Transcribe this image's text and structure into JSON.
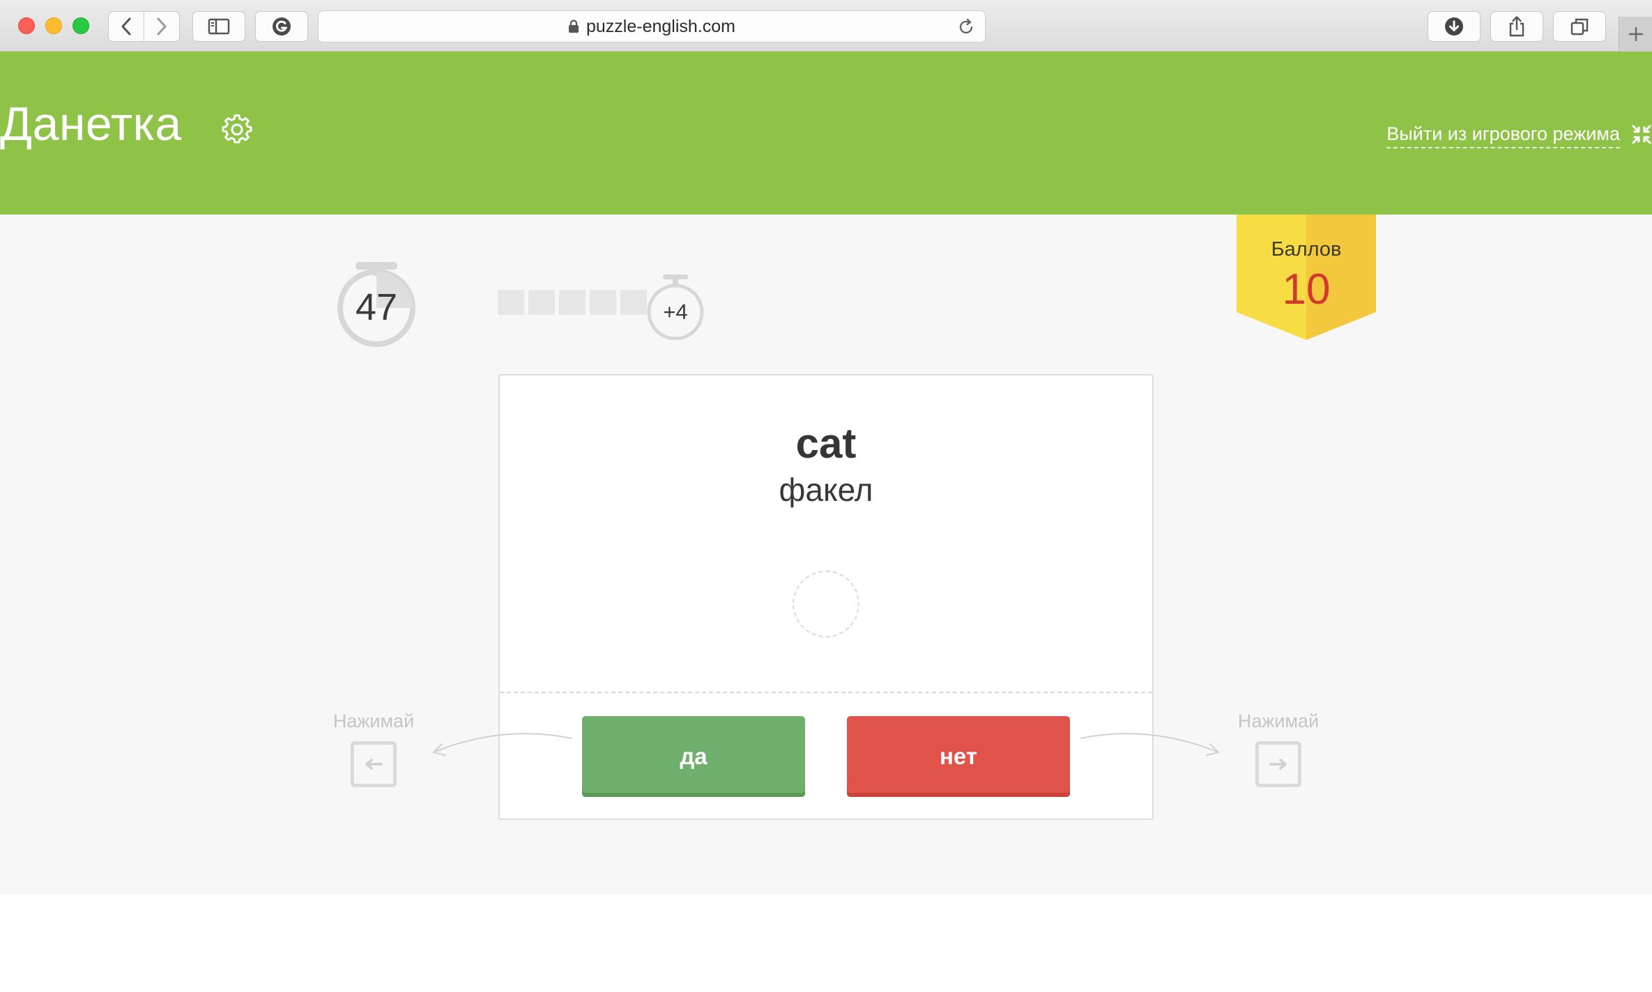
{
  "browser": {
    "url": "puzzle-english.com"
  },
  "header": {
    "title": "Данетка",
    "exit_label": "Выйти из игрового режима"
  },
  "game": {
    "timer_seconds": "47",
    "streak_cells_filled": 0,
    "streak_cells_total": 5,
    "bonus": "+4",
    "score_label": "Баллов",
    "score_value": "10",
    "word": "cat",
    "translation": "факел",
    "yes_label": "да",
    "no_label": "нет",
    "hint_left": "Нажимай",
    "hint_right": "Нажимай"
  },
  "colors": {
    "header_green": "#8fc348",
    "yes_green": "#6faf6e",
    "no_red": "#df534a",
    "badge_yellow": "#f6cf3e",
    "score_red": "#d0392b"
  }
}
